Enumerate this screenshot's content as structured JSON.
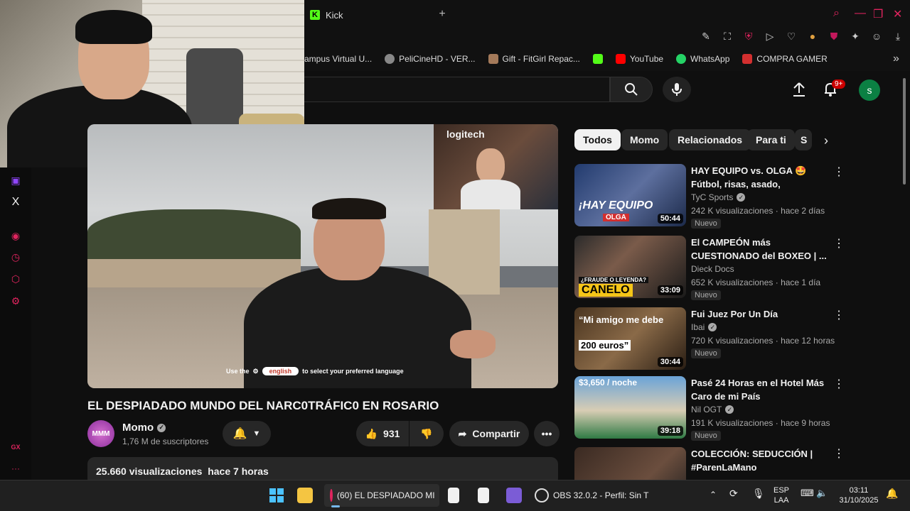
{
  "browser": {
    "tab_title": "Kick",
    "tab_icon": "kick-logo",
    "new_tab_label": "+",
    "bookmarks": [
      {
        "label": "ampus Virtual U...",
        "icon": "bookmark-icon"
      },
      {
        "label": "PeliCineHD - VER...",
        "icon": "bookmark-icon"
      },
      {
        "label": "Gift - FitGirl Repac...",
        "icon": "bookmark-icon"
      },
      {
        "label": "",
        "icon": "kick-icon"
      },
      {
        "label": "YouTube",
        "icon": "youtube-icon"
      },
      {
        "label": "WhatsApp",
        "icon": "whatsapp-icon"
      },
      {
        "label": "COMPRA GAMER",
        "icon": "compragamer-icon"
      }
    ],
    "bookmarks_more": "»"
  },
  "youtube_header": {
    "notifications_badge": "9+",
    "avatar_letter": "s"
  },
  "side_rail": {
    "icons": [
      "twitch-icon",
      "x-icon",
      "player-icon",
      "history-icon",
      "extensions-icon",
      "settings-icon",
      "gx-icon",
      "more-icon"
    ],
    "gx_label": "GX",
    "x_label": "X",
    "more_label": "···"
  },
  "player": {
    "pip_brand": "logitech",
    "subtitle_pre": "Use the",
    "subtitle_lang": "english",
    "subtitle_post": "to select your preferred language"
  },
  "video": {
    "title": "EL DESPIADADO MUNDO DEL NARC0TRÁFIC0 EN ROSARIO",
    "channel_name": "Momo",
    "channel_avatar_text": "MMM",
    "subscribers": "1,76 M de suscriptores",
    "likes": "931",
    "share_label": "Compartir",
    "views": "25.660 visualizaciones",
    "posted": "hace 7 horas"
  },
  "chips": [
    "Todos",
    "Momo",
    "Relacionados",
    "Para ti",
    "S"
  ],
  "recommendations": [
    {
      "title": "HAY EQUIPO vs. OLGA 🤩 Fútbol, risas, asado, anécdota...",
      "channel": "TyC Sports",
      "verified": true,
      "meta": "242 K visualizaciones · hace 2 días",
      "badge": "Nuevo",
      "duration": "50:44",
      "thumb_text": "¡HAY EQUIPO",
      "thumb_sub": "OLGA"
    },
    {
      "title": "El CAMPEÓN más CUESTIONADO del BOXEO | ...",
      "channel": "Dieck Docs",
      "verified": false,
      "meta": "652 K visualizaciones · hace 1 día",
      "badge": "Nuevo",
      "duration": "33:09",
      "thumb_text": "¿FRAUDE O LEYENDA?",
      "thumb_sub": "CANELO"
    },
    {
      "title": "Fui Juez Por Un Día",
      "channel": "Ibai",
      "verified": true,
      "meta": "720 K visualizaciones · hace 12 horas",
      "badge": "Nuevo",
      "duration": "30:44",
      "thumb_text": "“Mi amigo me debe",
      "thumb_sub": "200 euros”"
    },
    {
      "title": "Pasé 24 Horas en el Hotel Más Caro de mi País",
      "channel": "Nil OGT",
      "verified": true,
      "meta": "191 K visualizaciones · hace 9 horas",
      "badge": "Nuevo",
      "duration": "39:18",
      "thumb_text": "$3,650 / noche",
      "thumb_sub": ""
    },
    {
      "title": "COLECCIÓN: SEDUCCIÓN | #ParenLaMano",
      "channel": "",
      "verified": false,
      "meta": "",
      "badge": "",
      "duration": "",
      "thumb_text": "",
      "thumb_sub": ""
    }
  ],
  "taskbar": {
    "browser_task": "(60) EL DESPIADADO MI",
    "obs_task": "OBS 32.0.2 - Perfil: Sin T",
    "lang_top": "ESP",
    "lang_bottom": "LAA",
    "time": "03:11",
    "date": "31/10/2025"
  },
  "colors": {
    "accent_opera": "#e0245e",
    "kick_green": "#53fc18",
    "youtube_red": "#ff0000",
    "badge_red": "#cc0000"
  }
}
